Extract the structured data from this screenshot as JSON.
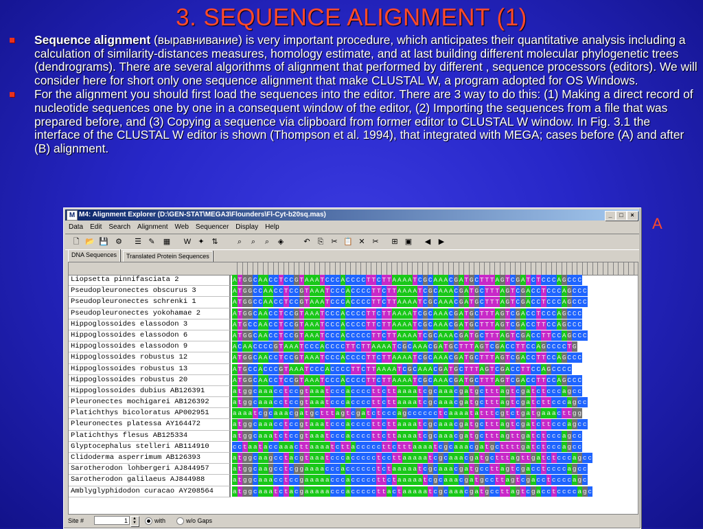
{
  "slide": {
    "title": "3. SEQUENCE ALIGNMENT (1)",
    "bullet1_bold": "Sequence alignment",
    "bullet1_text": " (выравнивание) is very important procedure, which anticipates their quantitative analysis including a calculation of similarity-distances measures, homology estimate, and at last building different molecular phylogenetic trees (dendrograms). There are several algorithms of alignment that performed by different , sequence processors (editors). We will consider here for short only one sequence alignment that make CLUSTAL W, a program adopted for OS Windows.",
    "bullet2_text": "For the alignment you should first load the sequences into the editor. There are 3 way to do this: (1) Making a direct record of nucleotide sequences one by one in a consequent window of the editor, (2) Importing the sequences from a file that was prepared before, and (3) Copying a sequence via clipboard from former editor to CLUSTAL W window. In Fig. 3.1 the interface of the CLUSTAL W  editor is shown (Thompson et al. 1994), that integrated with MEGA; cases before (A) and after (B) alignment.",
    "figure_label": "A"
  },
  "window": {
    "icon_letter": "M",
    "title": "M4: Alignment Explorer (D:\\GEN-STAT\\MEGA3\\Flounders\\Fl-Cyt-b20sq.mas)",
    "minimize": "_",
    "maximize": "□",
    "close": "×",
    "menu": [
      "Data",
      "Edit",
      "Search",
      "Alignment",
      "Web",
      "Sequencer",
      "Display",
      "Help"
    ],
    "toolbar_icons": [
      "new-icon",
      "open-icon",
      "save-icon",
      "export-icon",
      "align-icon",
      "edit-icon",
      "align-codons-icon",
      "web-query-icon",
      "blast-icon",
      "sequencer-icon",
      "search-icon",
      "find-next-icon",
      "find-prev-icon",
      "highlight-icon",
      "undo-icon",
      "copy-icon",
      "cut-icon",
      "paste-icon",
      "delete-icon",
      "delete-gap-icon",
      "insert-icon",
      "mark-icon",
      "prev-site-icon",
      "next-site-icon"
    ],
    "tabs": [
      "DNA Sequences",
      "Translated Protein Sequences"
    ],
    "status": {
      "site_label": "Site #",
      "site_value": "1",
      "with_label": "with",
      "without_label": "w/o Gaps",
      "spin_up": "▲",
      "spin_down": "▼"
    }
  },
  "sequences": [
    {
      "name": "Liopsetta pinnifasciata 2",
      "seq": "ATGGCAACCTCCGTAAATCCCACCCCTTCTTAAAATCGCAAACGATGCTTTAGTCGATCTCCCAGCCC",
      "case": "upper"
    },
    {
      "name": "Pseudopleuronectes obscurus 3",
      "seq": "ATGGCCAACCTCCGTAAATCCCACCCCTTCTTAAAATCGCAAACGATGCTTTAGTCGACCTCCCAGCCC",
      "case": "upper"
    },
    {
      "name": "Pseudopleuronectes schrenki 1",
      "seq": "ATGGCCAACCTCCGTAAATCCCACCCCTTCTTAAAATCGCAAACGATGCTTTAGTCGACCTCCCAGCCC",
      "case": "upper"
    },
    {
      "name": "Pseudopleuronectes yokohamae 2",
      "seq": "ATGGCAACCTCCGTAAATCCCACCCCTTCTTAAAATCGCAAACGATGCTTTAGTCGACCTCCCAGCCC",
      "case": "upper"
    },
    {
      "name": "Hippoglossoides elassodon 3",
      "seq": "ATGCCAACCTCCGTAAATCCCACCCCTTCTTAAAATCGCAAACGATGCTTTAGTCGACCTTCCAGCCC",
      "case": "upper"
    },
    {
      "name": "Hippoglossoides elassodon 6",
      "seq": "ATGGCAACCTCCGTAAATCCCACCCCCTTCTTAAAATCGCAAACGATGCTTTAGTCGACCTTCCAGCCC",
      "case": "upper"
    },
    {
      "name": "Hippoglossoides elassodon 9",
      "seq": "ACAACCCCGTAAATCCCACCCCTTCTTAAAATCGCAAACGATGCTTTAGTCGACCTTCCAGCCCCTG",
      "case": "upper"
    },
    {
      "name": "Hippoglossoides robustus 12",
      "seq": "ATGGCAACCTCCGTAAATCCCACCCCTTCTTAAAATCGCAAACGATGCTTTAGTCGACCTTCCAGCCC",
      "case": "upper"
    },
    {
      "name": "Hippoglossoides robustus 13",
      "seq": "ATGCCACCCGTAAATCCCACCCCTTCTTAAAATCGCAAACGATGCTTTAGTCGACCTTCCAGCCCC",
      "case": "upper"
    },
    {
      "name": "Hippoglossoides robustus 20",
      "seq": "ATGGCAACCTCCGTAAATCCCACCCCTTCTTAAAATCGCAAACGATGCTTTAGTCGACCTTCCAGCCC",
      "case": "upper"
    },
    {
      "name": "Hippoglossoides dubius AB126391",
      "seq": "atggcaaacctccgtaaatcccaccccttcttaaaatcgcaaacgatgctttagtcgatctcccagcc",
      "case": "lower"
    },
    {
      "name": "Pleuronectes mochigarei AB126392",
      "seq": "atggcaaacctccgtaaatcccaccccttcttaaaatcgcaaacgatgctttagtcgatcttcccagcc",
      "case": "lower"
    },
    {
      "name": "Platichthys bicoloratus AP002951",
      "seq": "aaaatcgcaaacgatgctttagtcgatctcccagcccccctcaaaatatttcgtctgatgaaacttgg",
      "case": "lower"
    },
    {
      "name": "Pleuronectes platessa AY164472",
      "seq": "atggcaaacctccgtaaatcccaccccttcttaaaatcgcaaacgatgctttagtcgatcttcccagcc",
      "case": "lower"
    },
    {
      "name": "Platichthys flesus AB125334",
      "seq": "atggcaaatctccgtaaatcccaccccttcttaaaatcgcaaacgatgctttagttgatctcccagcc",
      "case": "lower"
    },
    {
      "name": "Glyptocephalus stelleri AB114910",
      "seq": "cctaataccaaacttaaaatcttacccccttctttaaaatcgcaaacgatgcttttgatctcccagcc",
      "case": "lower"
    },
    {
      "name": "Clidoderma asperrimum AB126393",
      "seq": "atggcaagcctacgtaaatcccaccccctccttaaaaatcgcaaacgatgctttagttgatctcccagcc",
      "case": "lower"
    },
    {
      "name": "Sarotherodon lohbergeri AJ844957",
      "seq": "atggcaagcctcggaaaacccacccccctctaaaaatcgcaaacgatgccttagtcgacctccccagcc",
      "case": "lower"
    },
    {
      "name": "Sarotherodon galilaeus AJ844988",
      "seq": "atggcaaacctccgaaaaacccacccccttctaaaaatcgcaaacgatgccttagtcgacctccccagc",
      "case": "lower"
    },
    {
      "name": "Amblyglyphidodon curacao AY208564",
      "seq": "atggcaaatctacgaaaaacccacccccttactaaaaatcgcaaacgatgccttagtcgacctccccagc",
      "case": "lower"
    }
  ]
}
